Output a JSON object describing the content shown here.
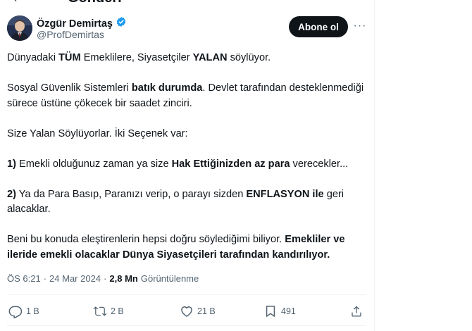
{
  "topbar": {
    "back_icon": "arrow-left-icon",
    "title": "Gönderi"
  },
  "author": {
    "name": "Özgür Demirtaş",
    "handle": "@ProfDemirtas",
    "verified_color": "#1d9bf0"
  },
  "follow_label": "Abone ol",
  "more_label": "···",
  "tweet": {
    "l1_a": "Dünyadaki ",
    "l1_b": "TÜM",
    "l1_c": " Emeklilere, Siyasetçiler ",
    "l1_d": "YALAN",
    "l1_e": " söylüyor.",
    "l2_a": "Sosyal Güvenlik Sistemleri ",
    "l2_b": "batık durumda",
    "l2_c": ". Devlet tarafından desteklenmediği sürece üstüne çökecek bir saadet zinciri.",
    "l3": "Size Yalan Söylüyorlar. İki Seçenek var:",
    "l4_a": "1)",
    "l4_b": " Emekli olduğunuz zaman ya size ",
    "l4_c": "Hak Ettiğinizden az para",
    "l4_d": " verecekler...",
    "l5_a": "2)",
    "l5_b": " Ya da Para Basıp, Paranızı verip, o parayı sizden ",
    "l5_c": "ENFLASYON ile",
    "l5_d": " geri alacaklar.",
    "l6_a": "Beni bu konuda eleştirenlerin hepsi doğru söylediğimi biliyor. ",
    "l6_b": "Emekliler ve ileride emekli olacaklar Dünya Siyasetçileri tarafından kandırılıyor."
  },
  "meta": {
    "time": "ÖS 6:21",
    "sep": "·",
    "date": "24 Mar 2024",
    "sep2": "·",
    "views_count": "2,8 Mn",
    "views_label": "Görüntülenme"
  },
  "actions": {
    "replies": "1 B",
    "reposts": "2 B",
    "likes": "21 B",
    "bookmarks": "491"
  },
  "colors": {
    "text": "#0f1419",
    "muted": "#536471",
    "border": "#eff3f4",
    "accent": "#1d9bf0"
  }
}
